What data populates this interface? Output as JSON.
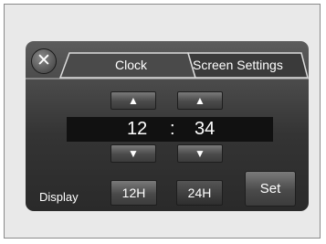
{
  "tabs": [
    {
      "label": "Clock",
      "active": true
    },
    {
      "label": "Screen Settings",
      "active": false
    }
  ],
  "close": {
    "glyph": "✕"
  },
  "time": {
    "hour": "12",
    "separator": ":",
    "minute": "34"
  },
  "arrows": {
    "up": "▲",
    "down": "▼"
  },
  "display": {
    "label": "Display",
    "options": [
      {
        "label": "12H",
        "selected": false
      },
      {
        "label": "24H",
        "selected": true
      }
    ]
  },
  "set_label": "Set"
}
